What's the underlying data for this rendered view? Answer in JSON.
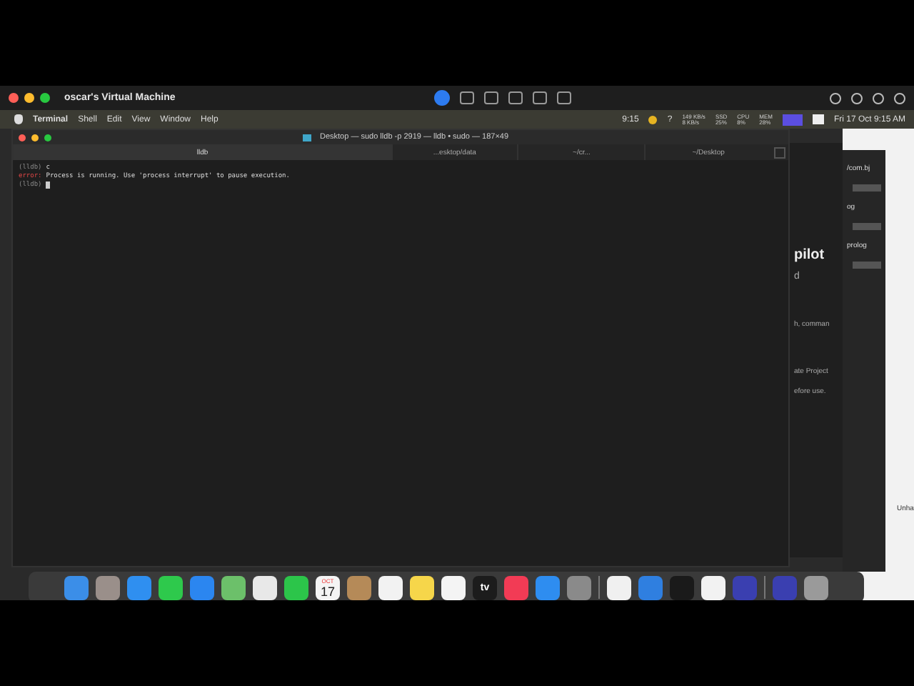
{
  "vm_window": {
    "title": "oscar's Virtual Machine"
  },
  "menu_bar": {
    "app": "Terminal",
    "items": [
      "Shell",
      "Edit",
      "View",
      "Window",
      "Help"
    ],
    "status": [
      {
        "kind": "text",
        "text": "9:15"
      },
      {
        "kind": "text",
        "text": "?"
      },
      {
        "kind": "stat",
        "label": "149 KB/s",
        "value": "8 KB/s"
      },
      {
        "kind": "stat",
        "label": "SSD",
        "value": "25%"
      },
      {
        "kind": "stat",
        "label": "CPU",
        "value": "8%"
      },
      {
        "kind": "stat",
        "label": "MEM",
        "value": "28%"
      },
      {
        "kind": "text",
        "text": "Fri 17 Oct  9:15 AM"
      }
    ]
  },
  "terminal": {
    "title": "Desktop — sudo lldb -p 2919 — lldb • sudo — 187×49",
    "tabs": [
      {
        "label": "lldb",
        "selected": true
      },
      {
        "label": "...esktop/data",
        "selected": false
      },
      {
        "label": "~/cr...",
        "selected": false
      },
      {
        "label": "~/Desktop",
        "selected": false
      }
    ],
    "lines": [
      {
        "prompt": "(lldb)",
        "text": "c"
      },
      {
        "prompt": "error:",
        "text": "Process is running.  Use 'process interrupt' to pause execution."
      },
      {
        "prompt": "(lldb)"
      }
    ]
  },
  "side_window": {
    "texts": [
      "pilot",
      "d",
      "h, comman",
      "ate Project",
      "efore use."
    ]
  },
  "inspector": {
    "texts": [
      "/com.bj",
      "og",
      "prolog"
    ]
  },
  "back_window": {
    "texts": [
      "Unha"
    ]
  },
  "dock": {
    "calendar_month": "OCT",
    "calendar_day": "17",
    "tv_label": "tv"
  }
}
